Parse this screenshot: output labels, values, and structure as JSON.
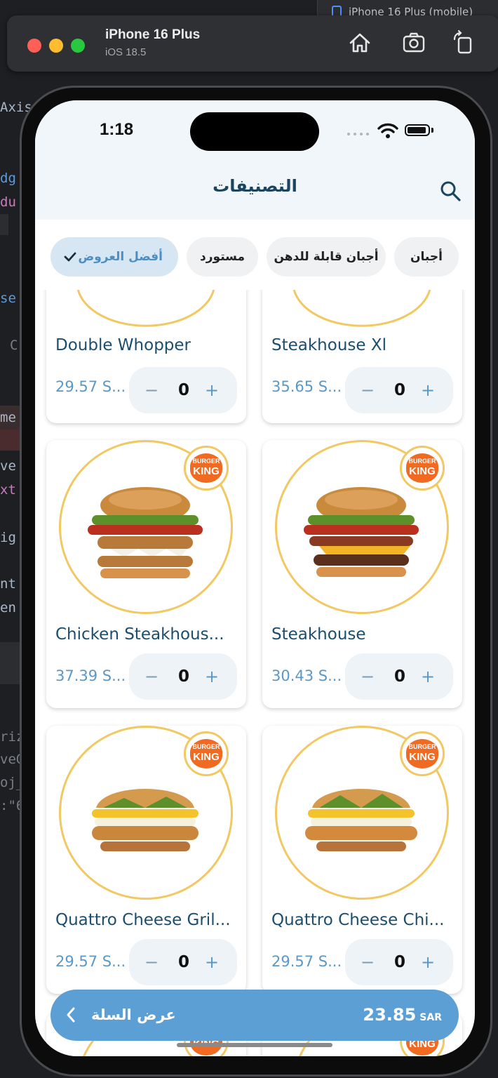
{
  "simulator": {
    "device_name": "iPhone 16 Plus",
    "os_version": "iOS 18.5",
    "ide_tab_label": "iPhone 16 Plus (mobile)"
  },
  "ide_code_fragments": [
    "AxisA",
    "dg",
    "du",
    "se",
    "C",
    "me",
    "ve",
    "xt",
    "ig",
    "nt",
    "en",
    "riz",
    "veG",
    "oj_",
    ":\"6"
  ],
  "status_bar": {
    "time": "1:18"
  },
  "header": {
    "title": "التصنيفات",
    "search_icon": "search-icon"
  },
  "categories": [
    {
      "label": "أفضل العروض",
      "selected": true
    },
    {
      "label": "مستورد",
      "selected": false
    },
    {
      "label": "أجبان قابلة للدهن",
      "selected": false
    },
    {
      "label": "أجبان",
      "selected": false
    }
  ],
  "products": [
    {
      "name": "Double Whopper",
      "price": "29.57 S...",
      "qty": "0"
    },
    {
      "name": "Steakhouse Xl",
      "price": "35.65 S...",
      "qty": "0"
    },
    {
      "name": "Chicken Steakhous...",
      "price": "37.39 S...",
      "qty": "0"
    },
    {
      "name": "Steakhouse",
      "price": "30.43 S...",
      "qty": "0"
    },
    {
      "name": "Quattro Cheese Gril...",
      "price": "29.57 S...",
      "qty": "0"
    },
    {
      "name": "Quattro Cheese Chi...",
      "price": "29.57 S...",
      "qty": "0"
    }
  ],
  "stepper_symbols": {
    "minus": "−",
    "plus": "+"
  },
  "brand_badge": {
    "line1": "BURGER",
    "line2": "KING"
  },
  "cart": {
    "label": "عرض السلة",
    "total": "23.85",
    "currency": "SAR"
  },
  "colors": {
    "accent": "#5c9fd4",
    "chip_active": "#d6e6f3",
    "title": "#1a4560",
    "badge": "#f06a22"
  }
}
